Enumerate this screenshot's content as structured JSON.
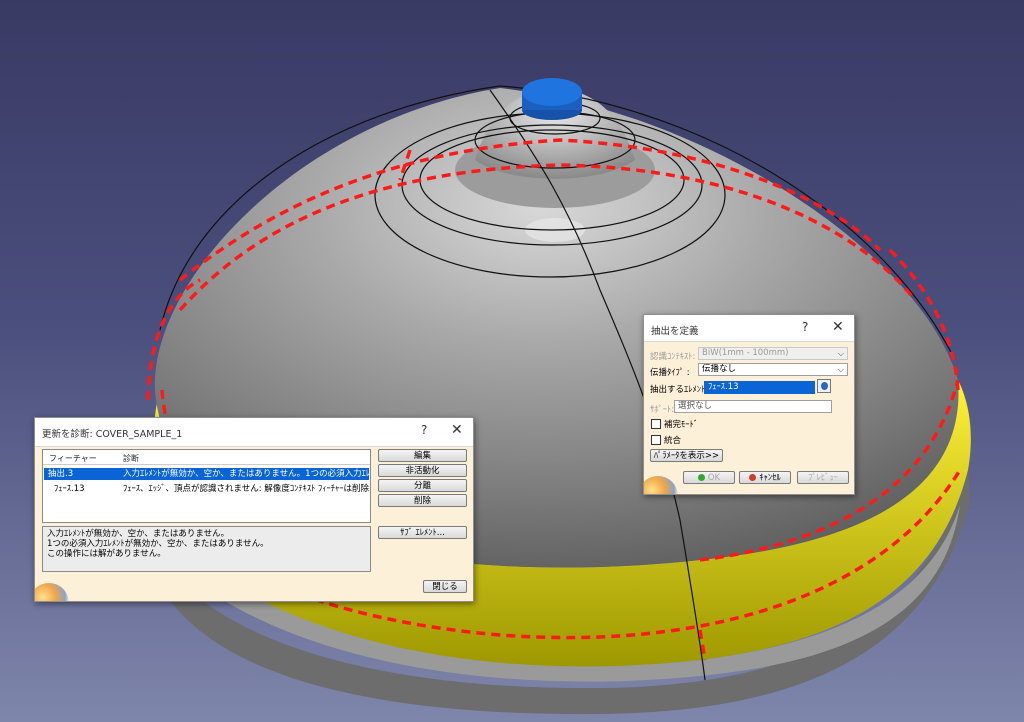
{
  "diagnose_dialog": {
    "title": "更新を診断: COVER_SAMPLE_1",
    "help": "?",
    "close": "✕",
    "columns": {
      "feature": "フィーチャー",
      "diagnosis": "診断"
    },
    "rows": [
      {
        "feature": "抽出.3",
        "diagnosis": "入力ｴﾚﾒﾝﾄが無効か、空か、またはありません。1つの必須入力ｴﾚﾒﾝﾄ...",
        "selected": true
      },
      {
        "feature": "ﾌｪｰｽ.13",
        "diagnosis": "ﾌｪｰｽ、ｴｯｼﾞ、頂点が認識されません: 解像度ｺﾝﾃｷｽﾄ ﾌｨｰﾁｬｰは削除...",
        "selected": false
      }
    ],
    "buttons": {
      "edit": "編集",
      "deactivate": "非活動化",
      "isolate": "分離",
      "delete": "削除",
      "sub_elements": "ｻﾌﾞ ｴﾚﾒﾝﾄ...",
      "close_btn": "閉じる"
    },
    "message_lines": [
      "入力ｴﾚﾒﾝﾄが無効か、空か、またはありません。",
      "1つの必須入力ｴﾚﾒﾝﾄが無効か、空か、またはありません。",
      "この操作には解がありません。"
    ]
  },
  "extract_dialog": {
    "title": "抽出を定義",
    "help": "?",
    "close": "✕",
    "context_label": "認識ｺﾝﾃｷｽﾄ:",
    "context_value": "BiW(1mm - 100mm)",
    "propagation_label": "伝播ﾀｲﾌﾟ :",
    "propagation_value": "伝播なし",
    "element_label": "抽出するｴﾚﾒﾝﾄ:",
    "element_value": "ﾌｪｰｽ.13",
    "support_label": "ｻﾎﾟｰﾄ:",
    "support_value": "選択なし",
    "complement_label": "補完ﾓｰﾄﾞ",
    "federation_label": "統合",
    "params_button": "ﾊﾟﾗﾒｰﾀを表示>>",
    "ok": "OK",
    "cancel": "ｷｬﾝｾﾙ",
    "preview": "ﾌﾟﾚﾋﾞｭｰ",
    "colors": {
      "ok_dot": "#2eaa2e",
      "cancel_dot": "#d43a2a",
      "selection": "#0a64d6",
      "highlight": "#ff0000",
      "face_yellow": "#e6e000",
      "cylinder": "#1f6fd8"
    }
  }
}
